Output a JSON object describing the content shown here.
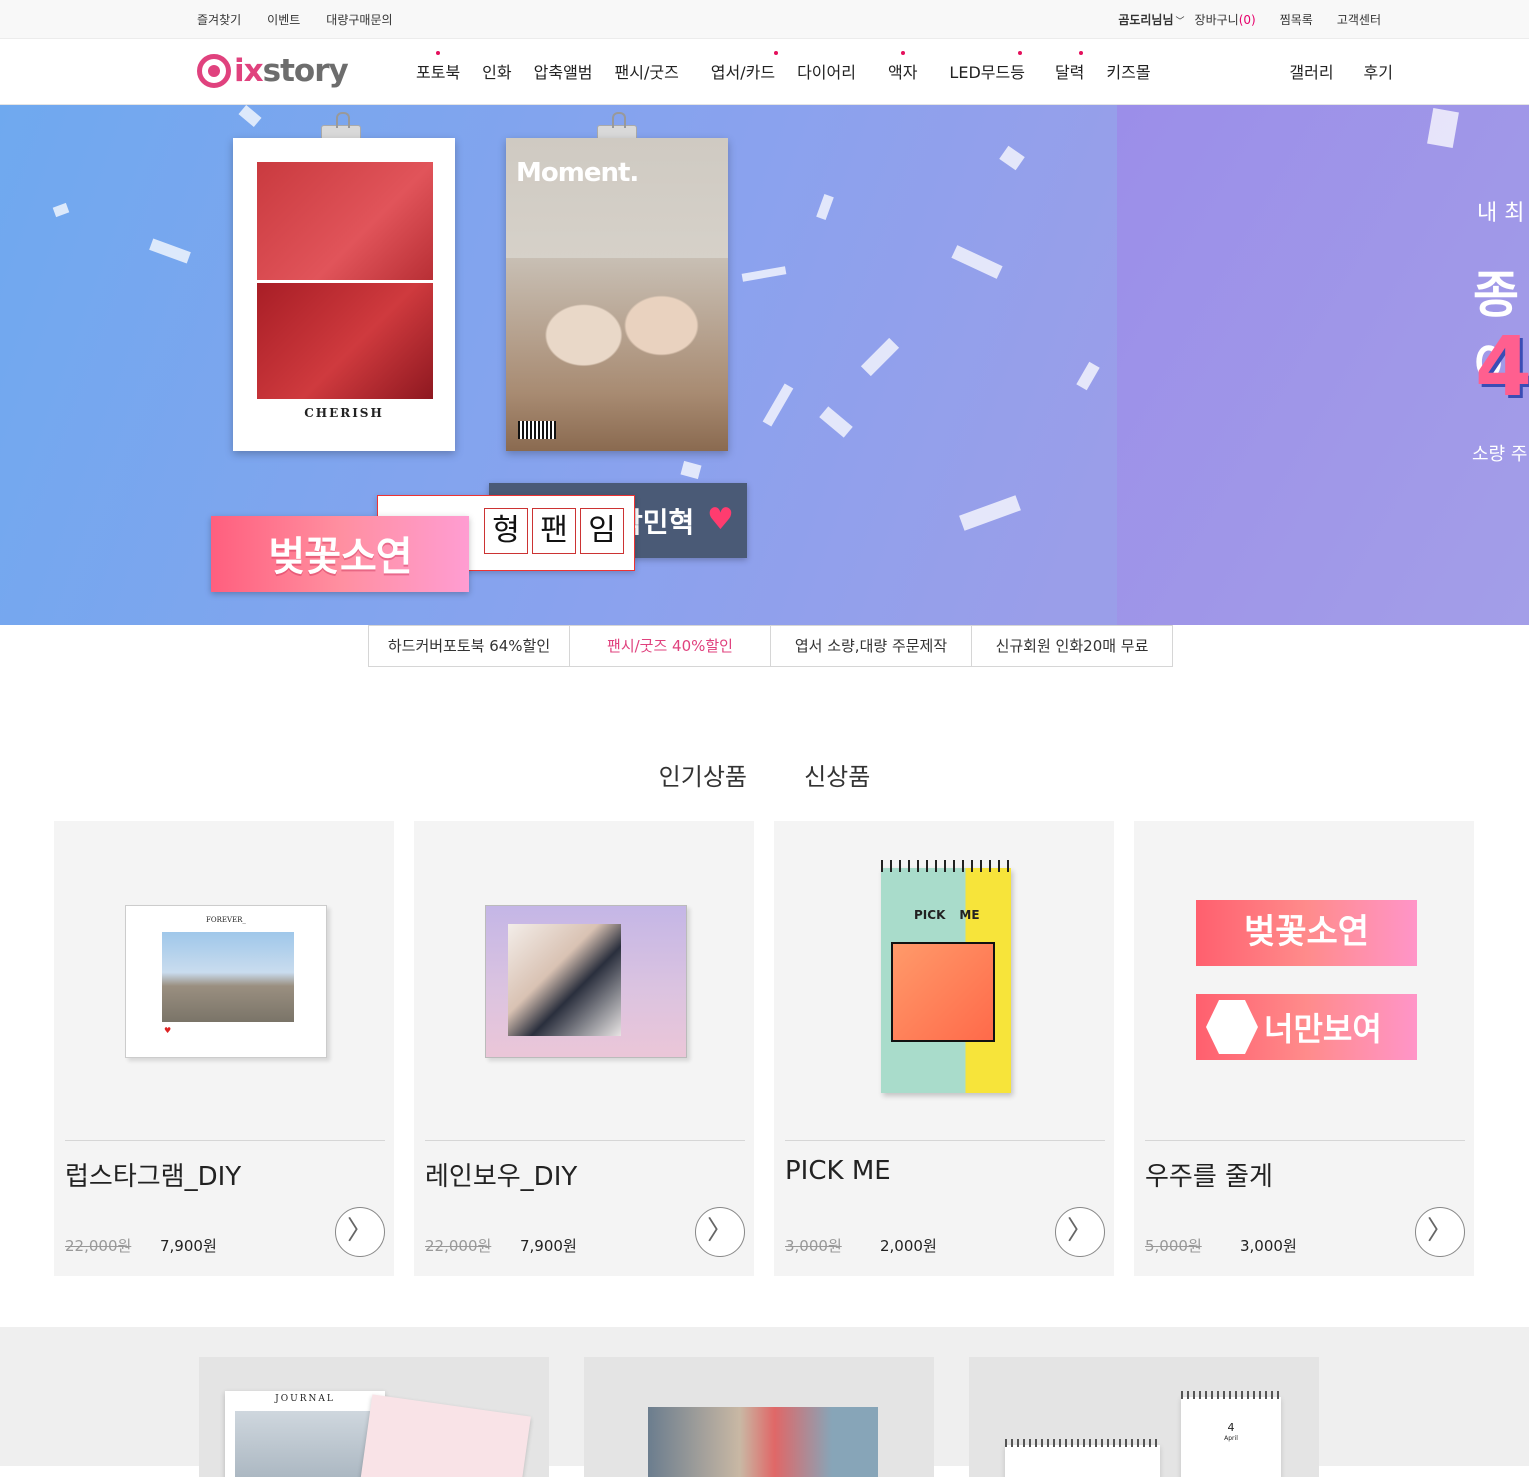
{
  "topbar": {
    "links": [
      "즐겨찾기",
      "이벤트",
      "대량구매문의"
    ],
    "user": "곰도리님님",
    "cart_label": "장바구니",
    "cart_count": "(0)",
    "wishlist": "찜목록",
    "support": "고객센터"
  },
  "brand": {
    "ix": "ix",
    "story": "story",
    "accent": "#e0427e"
  },
  "nav": {
    "items": [
      {
        "label": "포토북",
        "dot": true
      },
      {
        "label": "인화",
        "dot": false
      },
      {
        "label": "압축앨범",
        "dot": false
      },
      {
        "label": "팬시/굿즈",
        "dot": false
      },
      {
        "label": "엽서/카드",
        "dot": true
      },
      {
        "label": "다이어리",
        "dot": false
      },
      {
        "label": "액자",
        "dot": true
      },
      {
        "label": "LED무드등",
        "dot": true
      },
      {
        "label": "달력",
        "dot": true
      },
      {
        "label": "키즈몰",
        "dot": false
      }
    ],
    "right": [
      "갤러리",
      "후기"
    ]
  },
  "hero": {
    "cherish": "CHERISH",
    "moment": "Moment.",
    "banner_pink": "벚꽃소연",
    "banner_dark": "박민혁",
    "banner_grid": [
      "형",
      "팬",
      "임"
    ],
    "right_line1": "내 최",
    "right_line2": "종이",
    "right_line3": "4",
    "right_line4": "소량 주"
  },
  "promos": [
    {
      "label": "하드커버포토북 64%할인",
      "active": false
    },
    {
      "label": "팬시/굿즈 40%할인",
      "active": true
    },
    {
      "label": "엽서 소량,대량 주문제작",
      "active": false
    },
    {
      "label": "신규회원 인화20매 무료",
      "active": false
    }
  ],
  "section_tabs": [
    {
      "label": "인기상품",
      "active": true
    },
    {
      "label": "신상품",
      "active": false
    }
  ],
  "products": [
    {
      "name": "럽스타그램_DIY",
      "original": "22,000원",
      "price": "7,900원",
      "thumb": "instagram-book"
    },
    {
      "name": "레인보우_DIY",
      "original": "22,000원",
      "price": "7,900원",
      "thumb": "rainbow-book"
    },
    {
      "name": "PICK ME",
      "original": "3,000원",
      "price": "2,000원",
      "thumb": "pickme-notebook"
    },
    {
      "name": "우주를 줄게",
      "original": "5,000원",
      "price": "3,000원",
      "thumb": "slogan-banners"
    }
  ],
  "product_thumb_text": {
    "forever": "FOREVER_",
    "pick": "PICK",
    "me": "ME",
    "banner1": "벚꽃소연",
    "banner2": "너만보여"
  },
  "bottom": {
    "journal": "JOURNAL",
    "calendar_num": "4",
    "calendar_month": "April"
  }
}
